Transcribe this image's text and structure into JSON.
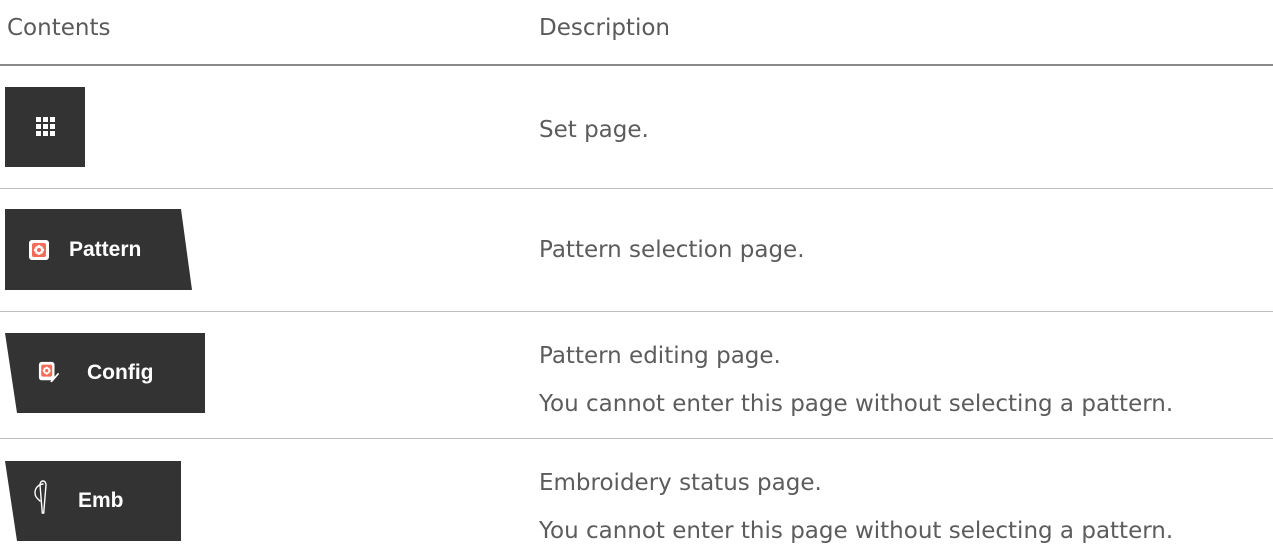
{
  "header": {
    "contents_label": "Contents",
    "description_label": "Description"
  },
  "rows": [
    {
      "button": {
        "label": "",
        "icon": "grid-icon"
      },
      "description": [
        "Set page."
      ]
    },
    {
      "button": {
        "label": "Pattern",
        "icon": "flower-pattern-icon"
      },
      "description": [
        "Pattern selection page."
      ]
    },
    {
      "button": {
        "label": "Config",
        "icon": "flower-edit-icon"
      },
      "description": [
        "Pattern editing page.",
        "You cannot enter this page without selecting a pattern."
      ]
    },
    {
      "button": {
        "label": "Emb",
        "icon": "needle-icon"
      },
      "description": [
        "Embroidery status page.",
        "You cannot enter this page without selecting a pattern."
      ]
    }
  ],
  "colors": {
    "button_bg": "#333333",
    "button_text": "#ffffff",
    "icon_accent": "#f26b5b",
    "text": "#5c5c5c",
    "divider": "#bdbdbd",
    "header_rule": "#8a8a8a"
  }
}
